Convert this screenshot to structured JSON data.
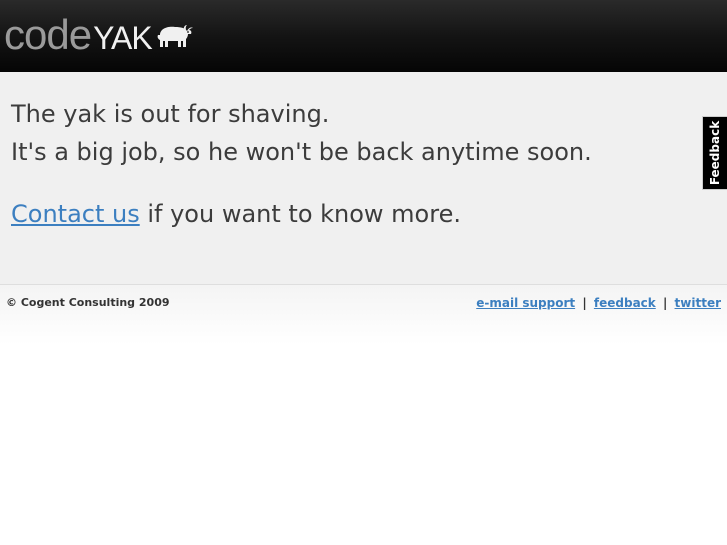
{
  "header": {
    "logo_code": "code",
    "logo_yak": "YAK",
    "logo_icon": "yak-icon"
  },
  "main": {
    "line1": "The yak is out for shaving.",
    "line2": "It's a big job, so he won't be back anytime soon.",
    "contact_link": "Contact us",
    "contact_suffix": " if you want to know more."
  },
  "feedback_tab": {
    "label": "Feedback"
  },
  "footer": {
    "copyright": "© Cogent Consulting 2009",
    "links": [
      "e-mail support",
      "feedback",
      "twitter"
    ],
    "separator": "|"
  },
  "colors": {
    "link": "#3c7fc0",
    "header_bg": "#0a0a0a",
    "content_bg": "#f0f0f0",
    "text": "#3c3c3c"
  }
}
